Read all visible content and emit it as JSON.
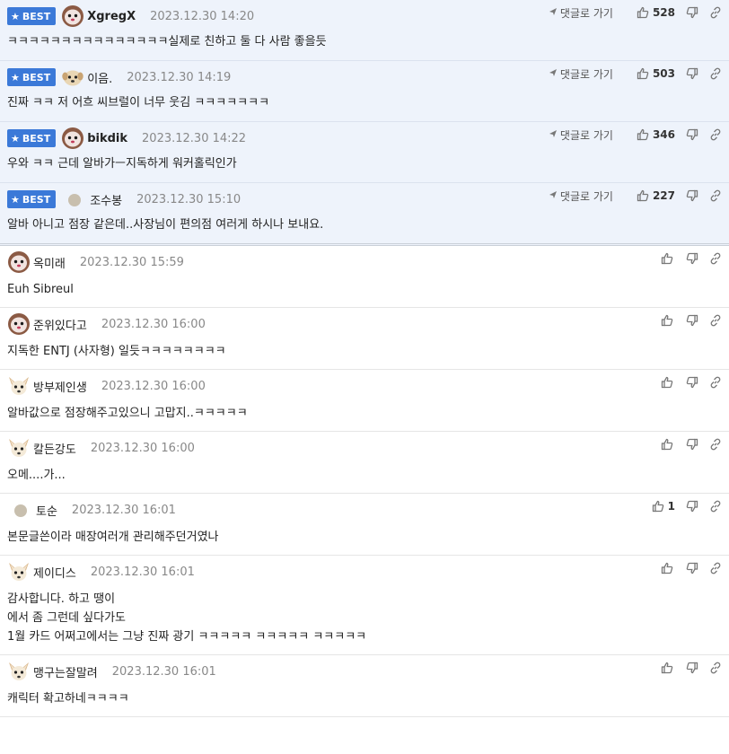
{
  "ui": {
    "best_label": "BEST",
    "reply_label": "댓글로 가기"
  },
  "comments": [
    {
      "best": true,
      "avatar": "dog-fluffy-icon",
      "nick": "XgregX",
      "nick_bold": true,
      "date": "2023.12.30 14:20",
      "lines": [
        "ㅋㅋㅋㅋㅋㅋㅋㅋㅋㅋㅋㅋㅋㅋㅋ실제로 친하고 둘 다 사람 좋을듯"
      ],
      "likes": "528"
    },
    {
      "best": true,
      "avatar": "puppy-face-icon",
      "nick": "이음.",
      "nick_bold": false,
      "date": "2023.12.30 14:19",
      "lines": [
        "진짜 ㅋㅋ 저 어흐 씨브럴이 너무 웃김 ㅋㅋㅋㅋㅋㅋㅋ"
      ],
      "likes": "503"
    },
    {
      "best": true,
      "avatar": "dog-fluffy-icon",
      "nick": "bikdik",
      "nick_bold": true,
      "date": "2023.12.30 14:22",
      "lines": [
        "우와 ㅋㅋ 근데 알바가ㅡ지독하게 워커홀릭인가"
      ],
      "likes": "346"
    },
    {
      "best": true,
      "avatar": "dot-avatar-icon",
      "nick": "조수봉",
      "nick_bold": false,
      "date": "2023.12.30 15:10",
      "lines": [
        "알바 아니고 점장 같은데..사장님이 편의점 여러게 하시나 보내요."
      ],
      "likes": "227"
    },
    {
      "best": false,
      "avatar": "dog-fluffy-icon",
      "nick": "옥미래",
      "nick_bold": false,
      "date": "2023.12.30 15:59",
      "lines": [
        "Euh Sibreul"
      ],
      "likes": ""
    },
    {
      "best": false,
      "avatar": "dog-fluffy-icon",
      "nick": "준위있다고",
      "nick_bold": false,
      "date": "2023.12.30 16:00",
      "lines": [
        "지독한 ENTJ (사자형) 일듯ㅋㅋㅋㅋㅋㅋㅋㅋ"
      ],
      "likes": ""
    },
    {
      "best": false,
      "avatar": "chihuahua-icon",
      "nick": "방부제인생",
      "nick_bold": false,
      "date": "2023.12.30 16:00",
      "lines": [
        "알바값으로 점장해주고있으니 고맙지..ㅋㅋㅋㅋㅋ"
      ],
      "likes": ""
    },
    {
      "best": false,
      "avatar": "chihuahua-icon",
      "nick": "칼든강도",
      "nick_bold": false,
      "date": "2023.12.30 16:00",
      "lines": [
        "오메....가..."
      ],
      "likes": ""
    },
    {
      "best": false,
      "avatar": "dot-avatar-icon",
      "nick": "토순",
      "nick_bold": false,
      "date": "2023.12.30 16:01",
      "lines": [
        "본문글쓴이라 매장여러개 관리해주던거였나"
      ],
      "likes": "1"
    },
    {
      "best": false,
      "avatar": "chihuahua-icon",
      "nick": "제이디스",
      "nick_bold": false,
      "date": "2023.12.30 16:01",
      "lines": [
        "감사합니다. 하고 땡이",
        "에서 좀 그런데 싶다가도",
        "1월 카드 어쩌고에서는 그냥 진짜 광기 ㅋㅋㅋㅋㅋ ㅋㅋㅋㅋㅋ ㅋㅋㅋㅋㅋ"
      ],
      "likes": ""
    },
    {
      "best": false,
      "avatar": "chihuahua-icon",
      "nick": "맹구는잘말려",
      "nick_bold": false,
      "date": "2023.12.30 16:01",
      "lines": [
        "캐릭터 확고하네ㅋㅋㅋㅋ"
      ],
      "likes": ""
    }
  ]
}
